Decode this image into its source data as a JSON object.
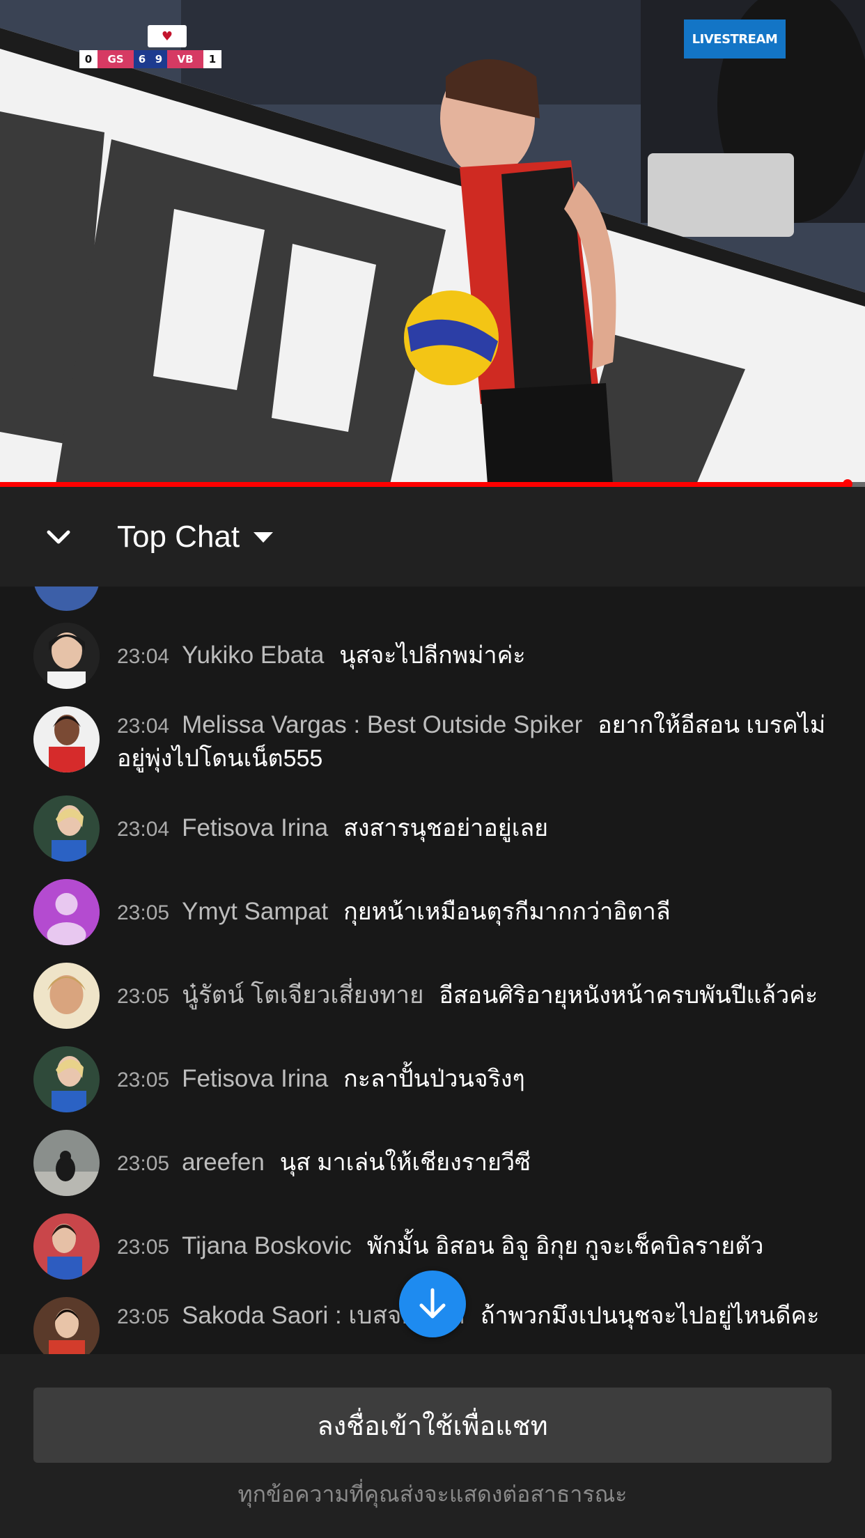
{
  "video": {
    "scoreboard": {
      "home_sets": "0",
      "home_team": "GS",
      "home_points": "6",
      "away_points": "9",
      "away_team": "VB",
      "away_sets": "1"
    },
    "badge": "LIVESTREAM",
    "progress": 0.98
  },
  "chat_header": {
    "mode_label": "Top Chat"
  },
  "messages": [
    {
      "time": "23:04",
      "author": "Yukiko Ebata",
      "text": "นุสจะไปลีกพม่าค่ะ"
    },
    {
      "time": "23:04",
      "author": "Melissa Vargas : Best Outside Spiker",
      "text": "อยากให้อีสอน เบรคไม่อยู่พุ่งไปโดนเน็ต555"
    },
    {
      "time": "23:04",
      "author": "Fetisova Irina",
      "text": "สงสารนุชอย่าอยู่เลย"
    },
    {
      "time": "23:05",
      "author": "Ymyt Sampat",
      "text": "กุยหน้าเหมือนตุรกีมากกว่าอิตาลี"
    },
    {
      "time": "23:05",
      "author": "นู๋รัตน์ โตเจียวเสี่ยงทาย",
      "text": "อีสอนศิริอายุหนังหน้าครบพันปีแล้วค่ะ"
    },
    {
      "time": "23:05",
      "author": "Fetisova Irina",
      "text": "กะลาปั้นป่วนจริงๆ"
    },
    {
      "time": "23:05",
      "author": "areefen",
      "text": "นุส มาเล่นให้เชียงรายวีซี"
    },
    {
      "time": "23:05",
      "author": "Tijana Boskovic",
      "text": "พักมั้น อิสอน อิจู อิกุย กูจะเช็คบิลรายตัว"
    },
    {
      "time": "23:05",
      "author": "Sakoda Saori : เบสจ... ...ค",
      "text": "ถ้าพวกมึงเปนนุชจะไปอยู่ไหนดีคะ"
    }
  ],
  "footer": {
    "signin_label": "ลงชื่อเข้าใช้เพื่อแชท",
    "note": "ทุกข้อความที่คุณส่งจะแสดงต่อสาธารณะ"
  },
  "icons": {
    "collapse": "chevron-down-icon",
    "mode_caret": "caret-down-icon",
    "scroll_down": "arrow-down-icon",
    "default_avatar": "person-icon"
  },
  "colors": {
    "accent_blue": "#1e8bf0",
    "progress_red": "#ff0000",
    "default_avatar_bg": "#b44bd0"
  }
}
